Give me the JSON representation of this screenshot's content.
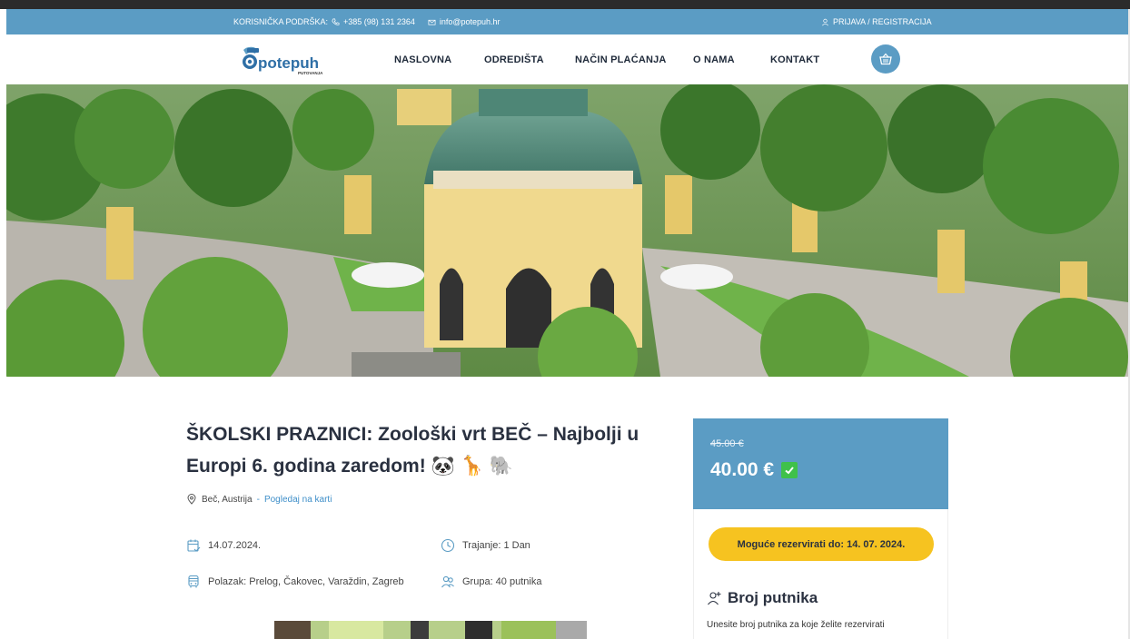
{
  "topbar": {
    "support_label": "KORISNIČKA PODRŠKA:",
    "phone": "+385 (98) 131 2364",
    "email": "info@potepuh.hr",
    "login": "PRIJAVA / REGISTRACIJA"
  },
  "brand": {
    "logo_text": "potepuh",
    "logo_sub": "PUTOVANJA"
  },
  "nav": {
    "items": [
      {
        "label": "NASLOVNA"
      },
      {
        "label": "ODREDIŠTA"
      },
      {
        "label": "NAČIN PLAĆANJA"
      },
      {
        "label": "O NAMA"
      },
      {
        "label": "KONTAKT"
      }
    ],
    "basket_icon": "basket-icon"
  },
  "trip": {
    "title": "ŠKOLSKI PRAZNICI: Zoološki vrt BEČ – Najbolji u Europi 6. godina zaredom! 🐼 🦒 🐘",
    "location": "Beč, Austrija",
    "location_sep": " - ",
    "map_link": "Pogledaj na karti",
    "date": "14.07.2024.",
    "duration": "Trajanje: 1 Dan",
    "departure": "Polazak: Prelog, Čakovec, Varaždin, Zagreb",
    "group": "Grupa: 40 putnika"
  },
  "pricing": {
    "old_price": "45.00 €",
    "new_price": "40.00 €",
    "deadline": "Moguće rezervirati do: 14. 07. 2024.",
    "passengers_title": "Broj putnika",
    "passengers_desc": "Unesite broj putnika za koje želite rezervirati"
  },
  "colors": {
    "accent": "#5b9cc4",
    "button": "#f6c320",
    "check": "#3fc14a",
    "link": "#3f8fc9"
  }
}
